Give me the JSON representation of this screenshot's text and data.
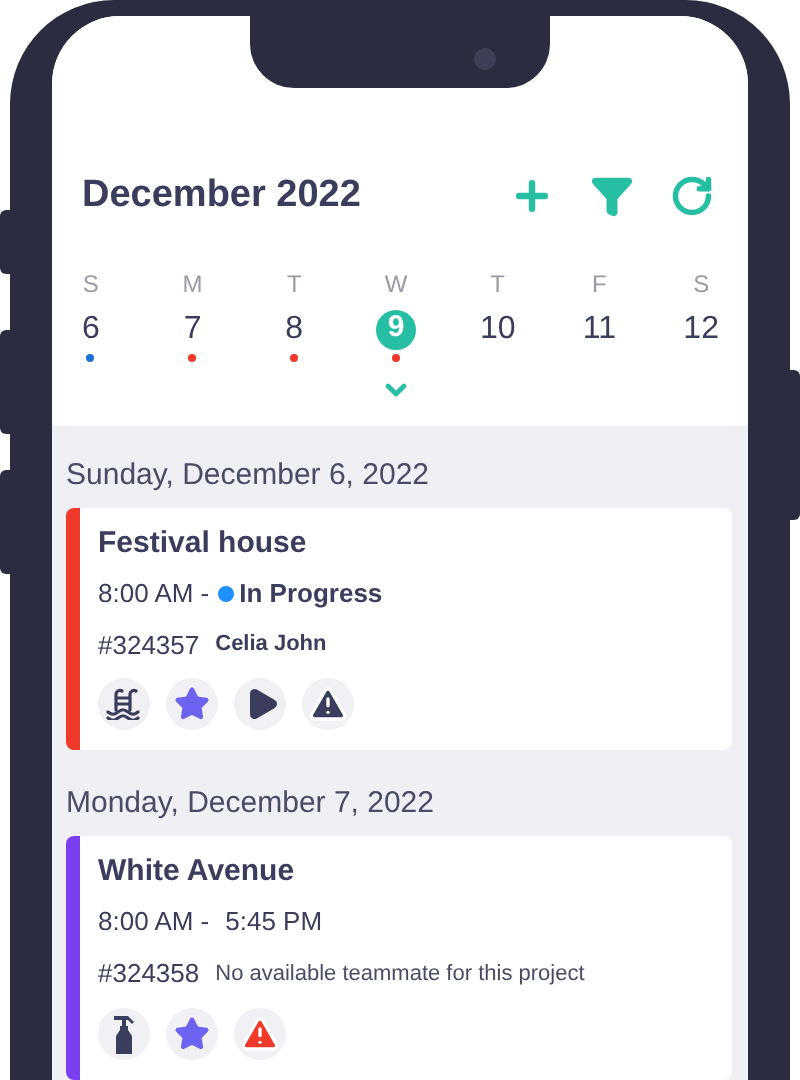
{
  "header": {
    "title": "December 2022",
    "actions": [
      {
        "kind": "add"
      },
      {
        "kind": "filter"
      },
      {
        "kind": "refresh"
      }
    ]
  },
  "week": [
    {
      "weekday": "S",
      "day": "6",
      "selected": false,
      "color": "#1e6fd9"
    },
    {
      "weekday": "M",
      "day": "7",
      "selected": false,
      "color": "#f0382b"
    },
    {
      "weekday": "T",
      "day": "8",
      "selected": false,
      "color": "#f0382b"
    },
    {
      "weekday": "W",
      "day": "9",
      "selected": true,
      "color": "#f0382b"
    },
    {
      "weekday": "T",
      "day": "10",
      "selected": false
    },
    {
      "weekday": "F",
      "day": "11",
      "selected": false
    },
    {
      "weekday": "S",
      "day": "12",
      "selected": false
    }
  ],
  "agenda": [
    {
      "date": "Sunday, December 6, 2022",
      "job": {
        "title": "Festival house",
        "color": "#f0382b",
        "start": "8:00 AM -",
        "status": {
          "label": "In Progress",
          "color": "#1e90ff"
        },
        "number": "#324357",
        "assignee": {
          "kind": "person",
          "text": "Celia John"
        },
        "icons": [
          {
            "kind": "pool"
          },
          {
            "kind": "favorite"
          },
          {
            "kind": "play"
          },
          {
            "kind": "warning"
          }
        ]
      }
    },
    {
      "date": "Monday, December 7, 2022",
      "job": {
        "title": "White Avenue",
        "color": "#7b3ff2",
        "start": "8:00 AM -",
        "end": "5:45 PM",
        "number": "#324358",
        "assignee": {
          "kind": "notice",
          "text": "No available teammate for this project"
        },
        "icons": [
          {
            "kind": "spray"
          },
          {
            "kind": "favorite"
          },
          {
            "kind": "alert"
          }
        ]
      }
    }
  ]
}
